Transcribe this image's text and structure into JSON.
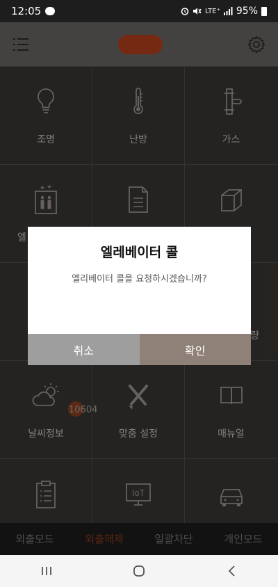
{
  "status": {
    "time": "12:05",
    "lte": "LTE⁺",
    "battery": "95%"
  },
  "grid": {
    "items": [
      {
        "label": "조명",
        "icon": "light-bulb-icon"
      },
      {
        "label": "난방",
        "icon": "thermometer-icon"
      },
      {
        "label": "가스",
        "icon": "gas-valve-icon"
      },
      {
        "label": "엘",
        "icon": "elevator-icon"
      },
      {
        "label": "",
        "icon": "document-icon"
      },
      {
        "label": "",
        "icon": "box-icon"
      },
      {
        "label": "",
        "icon": ""
      },
      {
        "label": "",
        "icon": ""
      },
      {
        "label": "량",
        "icon": ""
      },
      {
        "label": "날씨정보",
        "icon": "weather-icon"
      },
      {
        "label": "맞춤 설정",
        "icon": "tools-icon"
      },
      {
        "label": "매뉴얼",
        "icon": "book-icon"
      },
      {
        "label": "",
        "icon": "clipboard-icon"
      },
      {
        "label": "",
        "icon": "iot-icon"
      },
      {
        "label": "",
        "icon": "car-icon"
      }
    ],
    "badge": "10604",
    "iot_text": "IoT"
  },
  "bottom_tabs": [
    {
      "label": "외출모드"
    },
    {
      "label": "외출해제"
    },
    {
      "label": "일괄차단"
    },
    {
      "label": "개인모드"
    }
  ],
  "dialog": {
    "title": "엘레베이터 콜",
    "message": "엘리베이터 콜을 요청하시겠습니까?",
    "cancel": "취소",
    "confirm": "확인"
  }
}
